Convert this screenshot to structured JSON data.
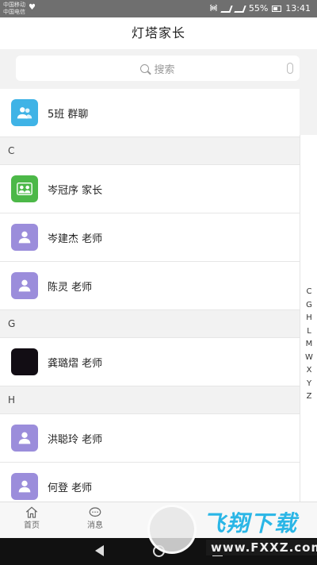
{
  "status_bar": {
    "carrier_line1": "中国移动",
    "carrier_line2": "中国电信",
    "battery": "55%",
    "time": "13:41"
  },
  "header": {
    "title": "灯塔家长"
  },
  "search": {
    "placeholder": "搜索"
  },
  "group_chat": {
    "label": "5班 群聊",
    "color": "#3fb3e6"
  },
  "sections": [
    {
      "letter": "C",
      "contacts": [
        {
          "name": "岑冠序 家长",
          "avatar": "parent-avatar-icon",
          "color": "#4cb848"
        },
        {
          "name": "岑建杰 老师",
          "avatar": "teacher-avatar-icon",
          "color": "#9b8ddb"
        },
        {
          "name": "陈灵 老师",
          "avatar": "teacher-avatar-icon",
          "color": "#9b8ddb"
        }
      ]
    },
    {
      "letter": "G",
      "contacts": [
        {
          "name": "龚璐熠 老师",
          "avatar": "photo-avatar",
          "color": "#120d14"
        }
      ]
    },
    {
      "letter": "H",
      "contacts": [
        {
          "name": "洪聪玲 老师",
          "avatar": "teacher-avatar-icon",
          "color": "#9b8ddb"
        },
        {
          "name": "何登 老师",
          "avatar": "teacher-avatar-icon",
          "color": "#9b8ddb"
        }
      ]
    }
  ],
  "index_letters": [
    "C",
    "G",
    "H",
    "L",
    "M",
    "W",
    "X",
    "Y",
    "Z"
  ],
  "tabs": [
    {
      "label": "首页",
      "icon": "home-icon"
    },
    {
      "label": "消息",
      "icon": "message-icon"
    }
  ],
  "watermark": {
    "title": "飞翔下载",
    "url": "www.FXXZ.com"
  }
}
